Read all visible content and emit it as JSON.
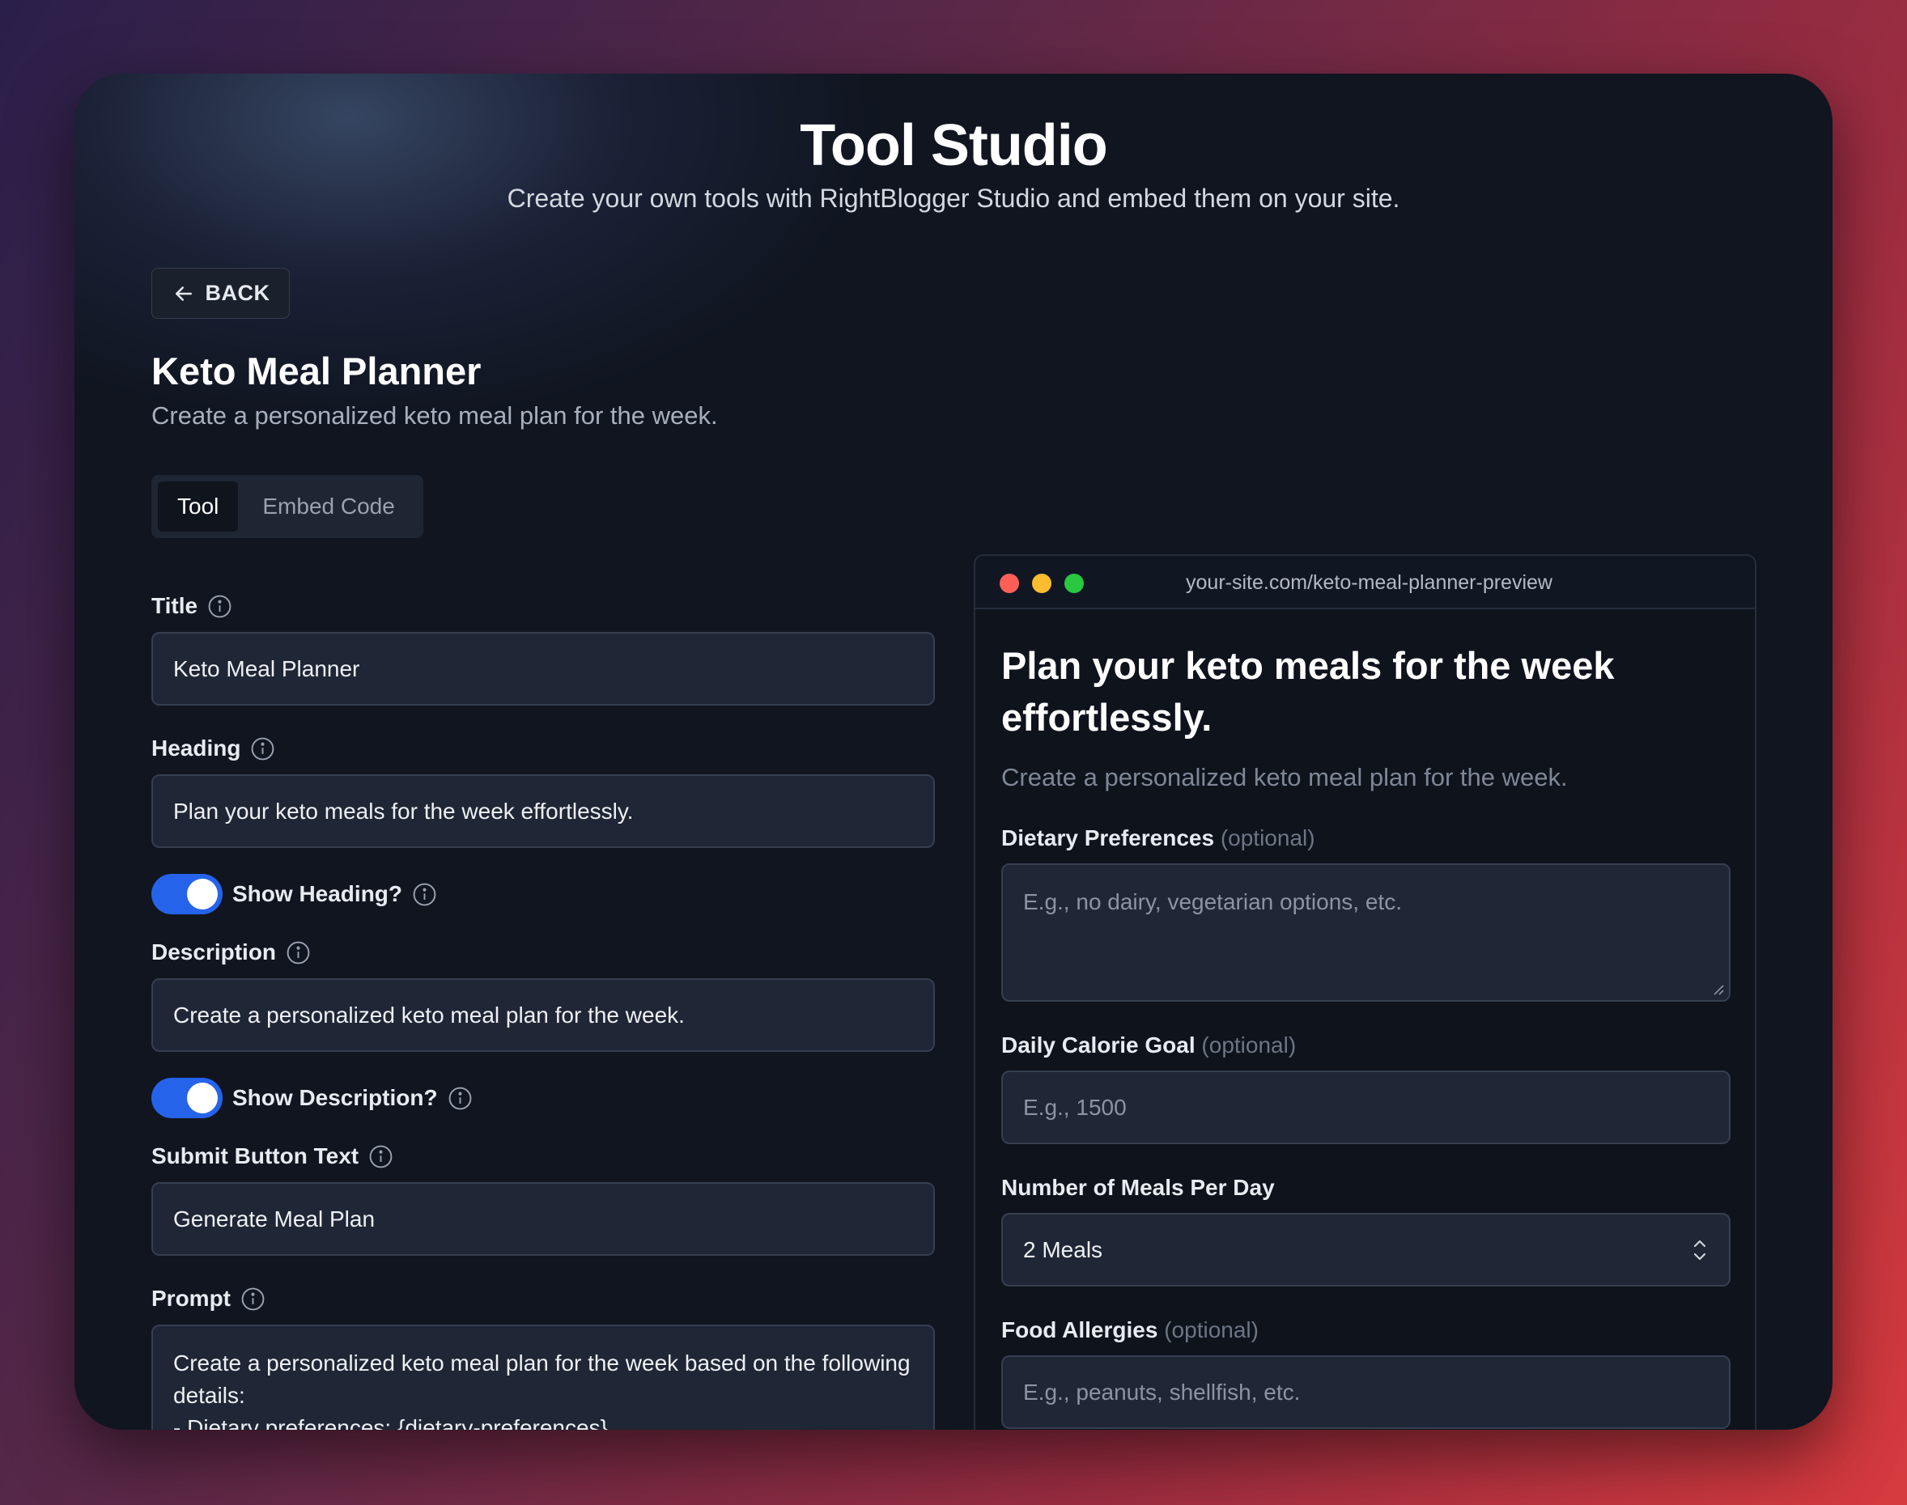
{
  "app": {
    "title": "Tool Studio",
    "subtitle": "Create your own tools with RightBlogger Studio and embed them on your site."
  },
  "back": {
    "label": "BACK",
    "icon": "arrow-left-icon"
  },
  "tool": {
    "name": "Keto Meal Planner",
    "description": "Create a personalized keto meal plan for the week."
  },
  "tabs": [
    {
      "label": "Tool",
      "active": true
    },
    {
      "label": "Embed Code",
      "active": false
    }
  ],
  "form": {
    "title_label": "Title",
    "title_value": "Keto Meal Planner",
    "heading_label": "Heading",
    "heading_value": "Plan your keto meals for the week effortlessly.",
    "show_heading_label": "Show Heading?",
    "show_heading": true,
    "description_label": "Description",
    "description_value": "Create a personalized keto meal plan for the week.",
    "show_description_label": "Show Description?",
    "show_description": true,
    "submit_label": "Submit Button Text",
    "submit_value": "Generate Meal Plan",
    "prompt_label": "Prompt",
    "prompt_value": "Create a personalized keto meal plan for the week based on the following details:\n- Dietary preferences: {dietary-preferences}"
  },
  "preview": {
    "url": "your-site.com/keto-meal-planner-preview",
    "heading": "Plan your keto meals for the week effortlessly.",
    "description": "Create a personalized keto meal plan for the week.",
    "optional_tag": "(optional)",
    "fields": {
      "dietary_label": "Dietary Preferences",
      "dietary_placeholder": "E.g., no dairy, vegetarian options, etc.",
      "calorie_label": "Daily Calorie Goal",
      "calorie_placeholder": "E.g., 1500",
      "meals_label": "Number of Meals Per Day",
      "meals_value": "2 Meals",
      "allergies_label": "Food Allergies",
      "allergies_placeholder": "E.g., peanuts, shellfish, etc."
    }
  },
  "colors": {
    "accent": "#2563eb",
    "window_bg": "#101520",
    "input_bg": "#1f2635",
    "traffic_red": "#ff5f57",
    "traffic_yellow": "#febc2e",
    "traffic_green": "#28c840"
  }
}
